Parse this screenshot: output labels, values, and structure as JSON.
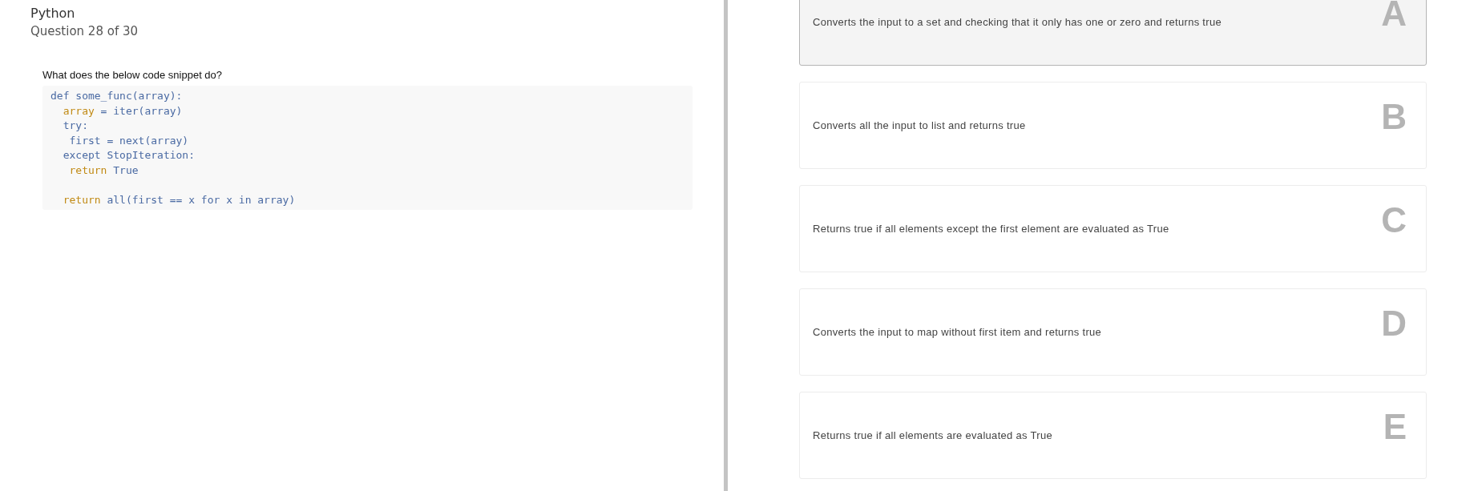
{
  "header": {
    "subject": "Python",
    "progress": "Question 28 of 30"
  },
  "question": {
    "prompt": "What does the below code snippet do?",
    "code": [
      {
        "segments": [
          {
            "text": "def some_func(array):",
            "kind": "plain"
          }
        ]
      },
      {
        "segments": [
          {
            "text": "  array",
            "kind": "keyword"
          },
          {
            "text": " = iter(array)",
            "kind": "plain"
          }
        ]
      },
      {
        "segments": [
          {
            "text": "  try:",
            "kind": "plain"
          }
        ]
      },
      {
        "segments": [
          {
            "text": "   first = next(array)",
            "kind": "plain"
          }
        ]
      },
      {
        "segments": [
          {
            "text": "  except StopIteration:",
            "kind": "plain"
          }
        ]
      },
      {
        "segments": [
          {
            "text": "   return",
            "kind": "keyword"
          },
          {
            "text": " True",
            "kind": "plain"
          }
        ]
      },
      {
        "gap_before": true,
        "segments": [
          {
            "text": "  return",
            "kind": "keyword"
          },
          {
            "text": " all(first == x for x in array)",
            "kind": "plain"
          }
        ]
      }
    ]
  },
  "answers": [
    {
      "letter": "A",
      "text": "Converts the input to a set and checking that it only has one or zero and returns true",
      "selected": true
    },
    {
      "letter": "B",
      "text": "Converts all the input to list and returns true",
      "selected": false
    },
    {
      "letter": "C",
      "text": "Returns true if all elements except the first element are evaluated as True",
      "selected": false
    },
    {
      "letter": "D",
      "text": "Converts the input to map without first item and returns true",
      "selected": false
    },
    {
      "letter": "E",
      "text": "Returns true if all elements are evaluated as True",
      "selected": false
    }
  ]
}
